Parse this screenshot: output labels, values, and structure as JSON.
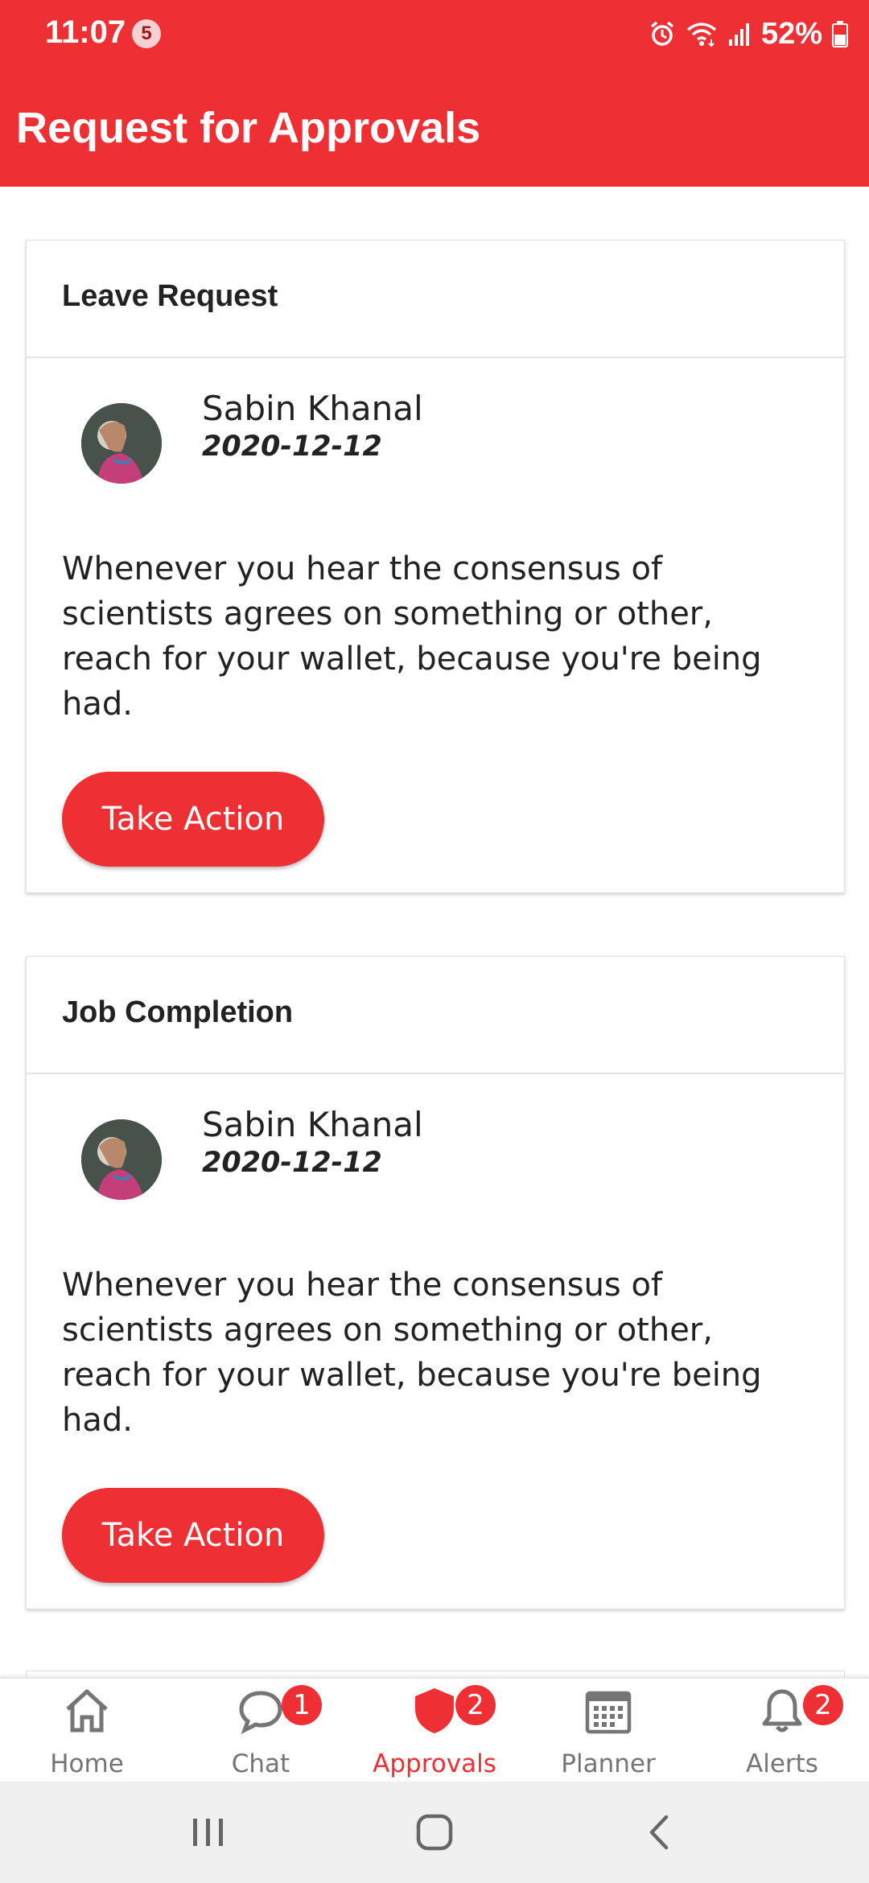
{
  "status_bar": {
    "time": "11:07",
    "notification_count": "5",
    "battery": "52%",
    "icons": [
      "alarm-icon",
      "wifi-icon",
      "signal-icon",
      "battery-icon"
    ]
  },
  "header": {
    "title": "Request for Approvals",
    "color": "#ee3035"
  },
  "cards": [
    {
      "title": "Leave Request",
      "author": "Sabin Khanal",
      "date": "2020-12-12",
      "body": "Whenever you hear the consensus of scientists agrees on something or other, reach for your wallet, because you're being had.",
      "button_label": "Take Action"
    },
    {
      "title": "Job Completion",
      "author": "Sabin Khanal",
      "date": "2020-12-12",
      "body": "Whenever you hear the consensus of scientists agrees on something or other, reach for your wallet, because you're being had.",
      "button_label": "Take Action"
    }
  ],
  "bottom_nav": {
    "active": "Approvals",
    "items": [
      {
        "label": "Home",
        "icon": "home-icon",
        "badge": ""
      },
      {
        "label": "Chat",
        "icon": "chat-icon",
        "badge": "1"
      },
      {
        "label": "Approvals",
        "icon": "shield-icon",
        "badge": "2"
      },
      {
        "label": "Planner",
        "icon": "calendar-icon",
        "badge": ""
      },
      {
        "label": "Alerts",
        "icon": "bell-icon",
        "badge": "2"
      }
    ]
  },
  "system_nav": {
    "icons": [
      "recent-apps-icon",
      "home-circle-icon",
      "back-icon"
    ]
  }
}
